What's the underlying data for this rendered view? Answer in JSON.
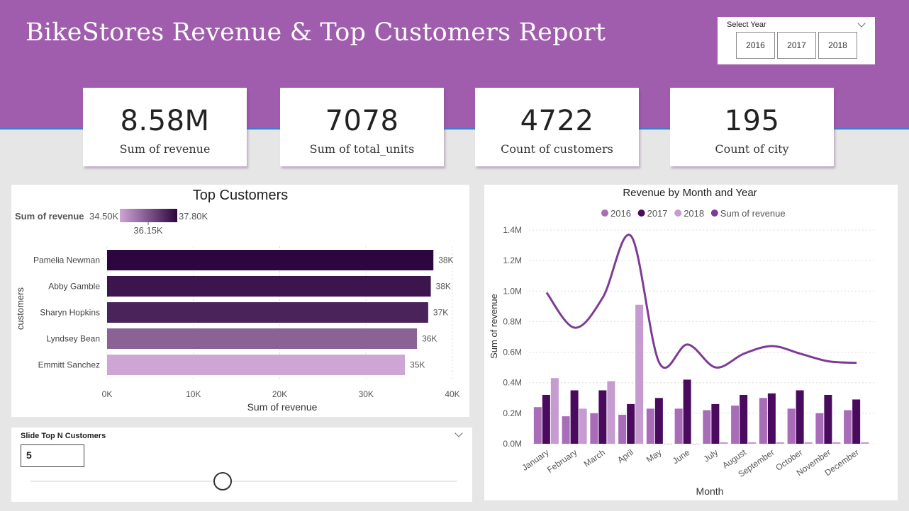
{
  "header": {
    "title": "BikeStores Revenue & Top Customers Report"
  },
  "year_slicer": {
    "title": "Select Year",
    "options": [
      "2016",
      "2017",
      "2018"
    ]
  },
  "kpis": [
    {
      "value": "8.58M",
      "label": "Sum of revenue"
    },
    {
      "value": "7078",
      "label": "Sum of total_units"
    },
    {
      "value": "4722",
      "label": "Count of customers"
    },
    {
      "value": "195",
      "label": "Count of city"
    }
  ],
  "topn_slicer": {
    "title": "Slide Top N Customers",
    "value": "5",
    "level_fraction": 0.45
  },
  "colors": {
    "header_bg": "#a05dad",
    "gradient_min": "#cfa5d6",
    "gradient_max": "#2d0640",
    "c2016": "#a86cb8",
    "c2017": "#4a0b5e",
    "c2018": "#c59bd0",
    "line": "#7e3b96"
  },
  "chart_data": [
    {
      "type": "bar",
      "orientation": "horizontal",
      "title": "Top Customers",
      "xlabel": "Sum of revenue",
      "ylabel": "customers",
      "legend": {
        "title": "Sum of revenue",
        "min_label": "34.50K",
        "mid_label": "36.15K",
        "max_label": "37.80K"
      },
      "categories": [
        "Pamelia Newman",
        "Abby Gamble",
        "Sharyn Hopkins",
        "Lyndsey Bean",
        "Emmitt Sanchez"
      ],
      "values": [
        37800,
        37500,
        37200,
        35900,
        34500
      ],
      "data_labels": [
        "38K",
        "38K",
        "37K",
        "36K",
        "35K"
      ],
      "xlim": [
        0,
        40000
      ],
      "xticks": [
        "0K",
        "10K",
        "20K",
        "30K",
        "40K"
      ],
      "grid": true
    },
    {
      "type": "bar+line",
      "title": "Revenue by Month and Year",
      "xlabel": "Month",
      "ylabel": "Sum of revenue",
      "legend_position": "top",
      "categories": [
        "January",
        "February",
        "March",
        "April",
        "May",
        "June",
        "July",
        "August",
        "September",
        "October",
        "November",
        "December"
      ],
      "series": [
        {
          "name": "2016",
          "kind": "bar",
          "values": [
            0.24,
            0.18,
            0.2,
            0.19,
            0.23,
            0.23,
            0.22,
            0.25,
            0.3,
            0.23,
            0.2,
            0.22
          ]
        },
        {
          "name": "2017",
          "kind": "bar",
          "values": [
            0.32,
            0.35,
            0.35,
            0.26,
            0.3,
            0.42,
            0.26,
            0.32,
            0.33,
            0.35,
            0.32,
            0.29
          ]
        },
        {
          "name": "2018",
          "kind": "bar",
          "values": [
            0.43,
            0.23,
            0.41,
            0.91,
            0.0,
            0.0,
            0.01,
            0.01,
            0.01,
            0.01,
            0.01,
            0.01
          ]
        },
        {
          "name": "Sum of revenue",
          "kind": "line",
          "values": [
            0.99,
            0.76,
            0.96,
            1.36,
            0.53,
            0.65,
            0.5,
            0.59,
            0.64,
            0.59,
            0.54,
            0.53
          ]
        }
      ],
      "ylim": [
        0,
        1.4
      ],
      "yticks": [
        "0.0M",
        "0.2M",
        "0.4M",
        "0.6M",
        "0.8M",
        "1.0M",
        "1.2M",
        "1.4M"
      ],
      "y_unit": "millions",
      "grid": true
    }
  ]
}
